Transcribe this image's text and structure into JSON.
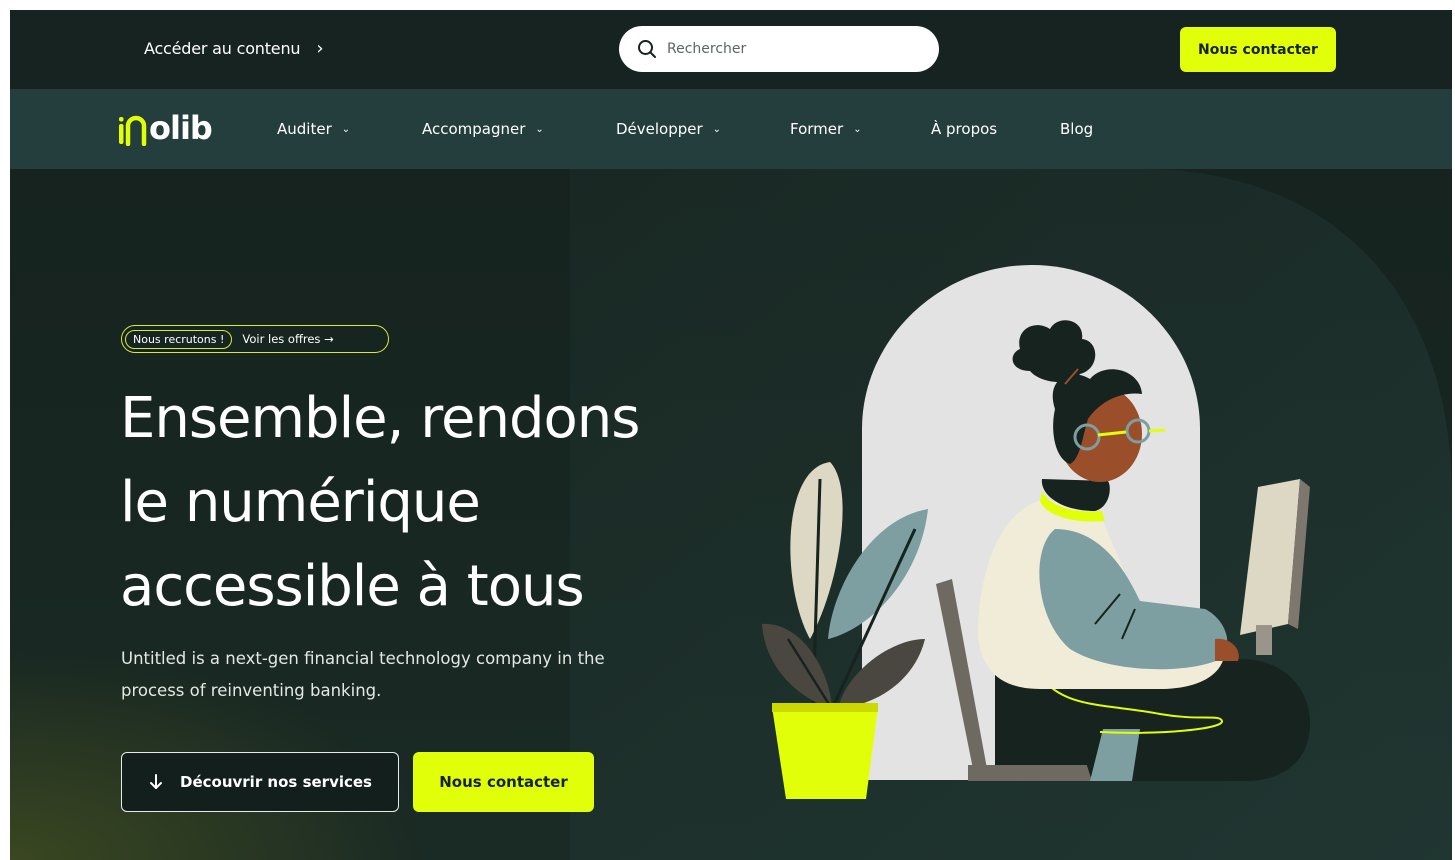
{
  "topbar": {
    "skip_link": "Accéder au contenu",
    "skip_chevron": "›",
    "search_placeholder": "Rechercher",
    "contact_button": "Nous contacter"
  },
  "nav": {
    "logo_text": "olib",
    "items": [
      {
        "label": "Auditer",
        "has_dropdown": true
      },
      {
        "label": "Accompagner",
        "has_dropdown": true
      },
      {
        "label": "Développer",
        "has_dropdown": true
      },
      {
        "label": "Former",
        "has_dropdown": true
      },
      {
        "label": "À propos",
        "has_dropdown": false
      },
      {
        "label": "Blog",
        "has_dropdown": false
      }
    ]
  },
  "hero": {
    "badge_label": "Nous recrutons !",
    "badge_link": "Voir les offres →",
    "headline": [
      "Ensemble, rendons",
      "le numérique",
      "accessible à tous"
    ],
    "lede": "Untitled is a next-gen financial technology company in the process of reinventing banking.",
    "cta_services": "Découvrir nos services",
    "cta_contact": "Nous contacter"
  },
  "colors": {
    "accent": "#e2ff0a",
    "topbar_bg": "#162320",
    "navbar_bg": "#243d3d",
    "hero_bg": "#16231f",
    "hero_curve": "#243d3d"
  }
}
